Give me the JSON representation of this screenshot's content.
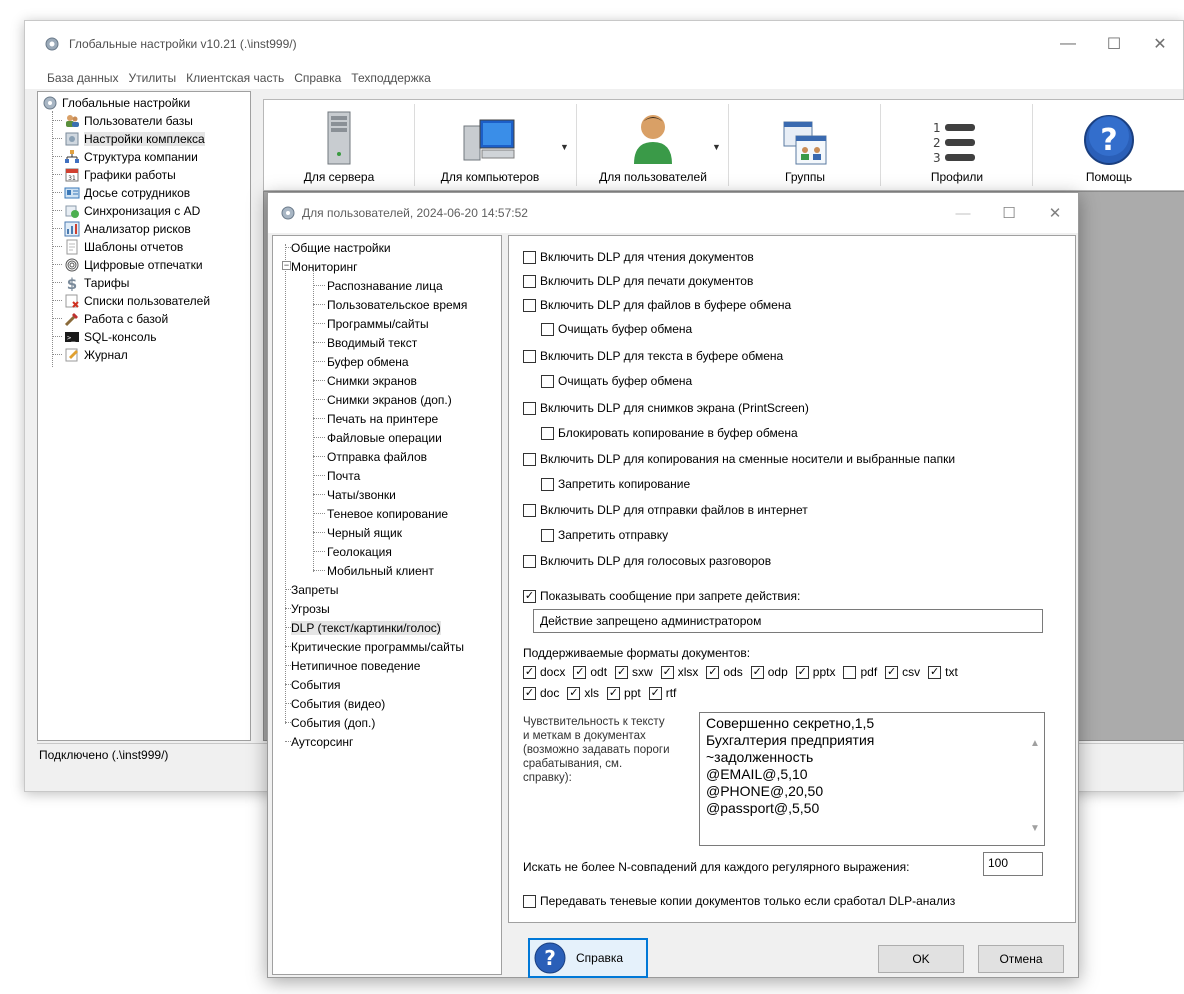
{
  "main_window": {
    "title": "Глобальные настройки v10.21 (.\\inst999/)",
    "menu": [
      "База данных",
      "Утилиты",
      "Клиентская часть",
      "Справка",
      "Техподдержка"
    ],
    "tree_root": "Глобальные настройки",
    "tree_items": [
      {
        "label": "Пользователи базы",
        "icon": "users-icon"
      },
      {
        "label": "Настройки комплекса",
        "icon": "complex-settings-icon"
      },
      {
        "label": "Структура компании",
        "icon": "org-structure-icon"
      },
      {
        "label": "Графики работы",
        "icon": "calendar-icon"
      },
      {
        "label": "Досье сотрудников",
        "icon": "dossier-icon"
      },
      {
        "label": "Синхронизация с AD",
        "icon": "sync-icon"
      },
      {
        "label": "Анализатор рисков",
        "icon": "risk-analyzer-icon"
      },
      {
        "label": "Шаблоны отчетов",
        "icon": "report-template-icon"
      },
      {
        "label": "Цифровые отпечатки",
        "icon": "fingerprint-icon"
      },
      {
        "label": "Тарифы",
        "icon": "dollar-icon"
      },
      {
        "label": "Списки пользователей",
        "icon": "user-list-icon"
      },
      {
        "label": "Работа с базой",
        "icon": "database-tools-icon"
      },
      {
        "label": "SQL-консоль",
        "icon": "console-icon"
      },
      {
        "label": "Журнал",
        "icon": "journal-icon"
      }
    ],
    "status": "Подключено (.\\inst999/)",
    "toolbar": [
      {
        "label": "Для сервера",
        "icon": "server-icon"
      },
      {
        "label": "Для компьютеров",
        "icon": "computer-icon"
      },
      {
        "label": "Для пользователей",
        "icon": "user-icon"
      },
      {
        "label": "Группы",
        "icon": "groups-icon"
      },
      {
        "label": "Профили",
        "icon": "profiles-icon"
      },
      {
        "label": "Помощь",
        "icon": "help-icon"
      }
    ]
  },
  "dialog": {
    "title": "Для пользователей, 2024-06-20 14:57:52",
    "tree": {
      "general": "Общие настройки",
      "monitoring": "Мониторинг",
      "monitoring_children": [
        "Распознавание лица",
        "Пользовательское время",
        "Программы/сайты",
        "Вводимый текст",
        "Буфер обмена",
        "Снимки экранов",
        "Снимки экранов (доп.)",
        "Печать на принтере",
        "Файловые операции",
        "Отправка файлов",
        "Почта",
        "Чаты/звонки",
        "Теневое копирование",
        "Черный ящик",
        "Геолокация",
        "Мобильный клиент"
      ],
      "after": [
        "Запреты",
        "Угрозы",
        "DLP (текст/картинки/голос)",
        "Критические программы/сайты",
        "Нетипичное поведение",
        "События",
        "События (видео)",
        "События (доп.)",
        "Аутсорсинг"
      ]
    },
    "options": {
      "dlp_read": "Включить DLP для чтения документов",
      "dlp_print": "Включить DLP для печати документов",
      "dlp_clipboard_files": "Включить DLP для файлов в буфере обмена",
      "clear_clipboard_1": "Очищать буфер обмена",
      "dlp_clipboard_text": "Включить DLP для текста в буфере обмена",
      "clear_clipboard_2": "Очищать буфер обмена",
      "dlp_printscreen": "Включить DLP для снимков экрана (PrintScreen)",
      "block_clipboard_copy": "Блокировать копирование в буфер обмена",
      "dlp_removable": "Включить DLP для копирования на сменные носители и выбранные папки",
      "forbid_copy": "Запретить копирование",
      "dlp_internet": "Включить DLP для отправки файлов в интернет",
      "forbid_send": "Запретить отправку",
      "dlp_voice": "Включить DLP для голосовых разговоров",
      "show_message": "Показывать сообщение при запрете действия:",
      "message_value": "Действие запрещено администратором",
      "formats_label": "Поддерживаемые форматы документов:",
      "formats": [
        {
          "name": "docx",
          "checked": true
        },
        {
          "name": "odt",
          "checked": true
        },
        {
          "name": "sxw",
          "checked": true
        },
        {
          "name": "xlsx",
          "checked": true
        },
        {
          "name": "ods",
          "checked": true
        },
        {
          "name": "odp",
          "checked": true
        },
        {
          "name": "pptx",
          "checked": true
        },
        {
          "name": "pdf",
          "checked": false
        },
        {
          "name": "csv",
          "checked": true
        },
        {
          "name": "txt",
          "checked": true
        },
        {
          "name": "doc",
          "checked": true
        },
        {
          "name": "xls",
          "checked": true
        },
        {
          "name": "ppt",
          "checked": true
        },
        {
          "name": "rtf",
          "checked": true
        }
      ],
      "sensitivity_label": [
        "Чувствительность к тексту",
        "и меткам в документах",
        "(возможно задавать пороги",
        "срабатывания, см.",
        "справку):"
      ],
      "sensitivity_lines": [
        "Совершенно секретно,1,5",
        "Бухгалтерия предприятия",
        "~задолженность",
        "@EMAIL@,5,10",
        "@PHONE@,20,50",
        "@passport@,5,50"
      ],
      "max_matches_label": "Искать не более N-совпадений для каждого регулярного выражения:",
      "max_matches_value": "100",
      "shadow_only_dlp": "Передавать теневые копии документов только если сработал DLP-анализ"
    },
    "buttons": {
      "help": "Справка",
      "ok": "OK",
      "cancel": "Отмена"
    }
  }
}
